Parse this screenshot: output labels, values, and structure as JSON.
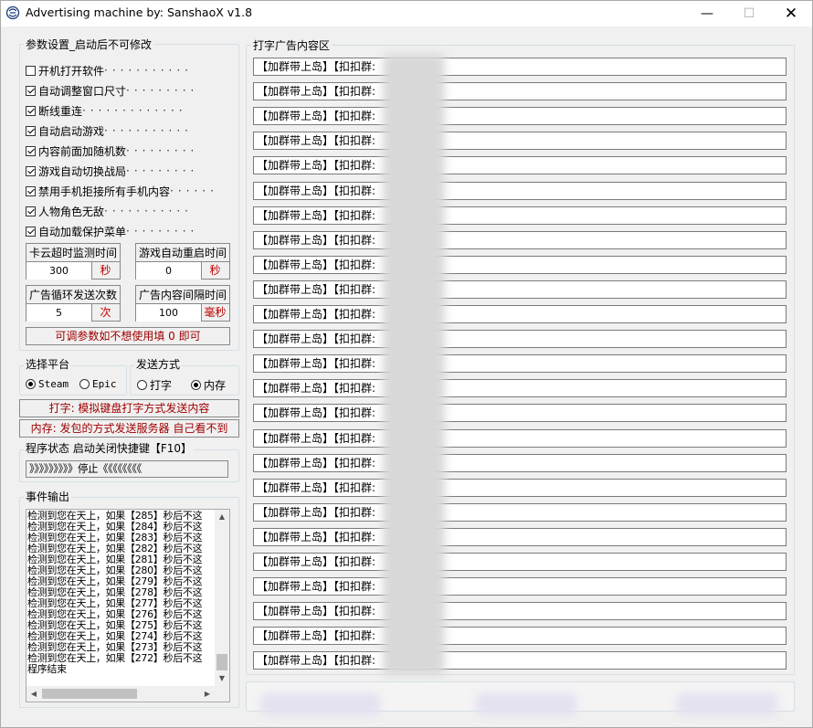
{
  "window": {
    "title": "Advertising machine by:  SanshaoX v1.8",
    "minimize": "—",
    "maximize": "☐",
    "close": "✕"
  },
  "params": {
    "group_label": "参数设置_启动后不可修改",
    "checkboxes": [
      {
        "label": "开机打开软件",
        "checked": false
      },
      {
        "label": "自动调整窗口尺寸",
        "checked": true
      },
      {
        "label": "断线重连",
        "checked": true
      },
      {
        "label": "自动启动游戏",
        "checked": true
      },
      {
        "label": "内容前面加随机数",
        "checked": true
      },
      {
        "label": "游戏自动切换战局",
        "checked": true
      },
      {
        "label": "禁用手机拒接所有手机内容",
        "checked": true
      },
      {
        "label": "人物角色无敌",
        "checked": true
      },
      {
        "label": "自动加载保护菜单",
        "checked": true
      }
    ],
    "fields": [
      {
        "label": "卡云超时监测时间",
        "value": "300",
        "unit": "秒"
      },
      {
        "label": "游戏自动重启时间",
        "value": "0",
        "unit": "秒"
      },
      {
        "label": "广告循环发送次数",
        "value": "5",
        "unit": "次"
      },
      {
        "label": "广告内容间隔时间",
        "value": "100",
        "unit": "毫秒"
      }
    ],
    "note": "可调参数如不想使用填 0 即可"
  },
  "platform": {
    "label": "选择平台",
    "options": [
      {
        "label": "Steam",
        "selected": true
      },
      {
        "label": "Epic",
        "selected": false
      }
    ]
  },
  "send_mode": {
    "label": "发送方式",
    "options": [
      {
        "label": "打字",
        "selected": false
      },
      {
        "label": "内存",
        "selected": true
      }
    ]
  },
  "hints": {
    "typing": "打字: 模拟键盘打字方式发送内容",
    "memory": "内存: 发包的方式发送服务器 自己看不到"
  },
  "status": {
    "label": "程序状态 启动关闭快捷键【F10】",
    "text": "》》》》》》》》》停止《《《《《《《《"
  },
  "events": {
    "label": "事件输出",
    "lines": [
      "检测到您在天上，如果【285】秒后不这",
      "检测到您在天上，如果【284】秒后不这",
      "检测到您在天上，如果【283】秒后不这",
      "检测到您在天上，如果【282】秒后不这",
      "检测到您在天上，如果【281】秒后不这",
      "检测到您在天上，如果【280】秒后不这",
      "检测到您在天上，如果【279】秒后不这",
      "检测到您在天上，如果【278】秒后不这",
      "检测到您在天上，如果【277】秒后不这",
      "检测到您在天上，如果【276】秒后不这",
      "检测到您在天上，如果【275】秒后不这",
      "检测到您在天上，如果【274】秒后不这",
      "检测到您在天上，如果【273】秒后不这",
      "检测到您在天上，如果【272】秒后不这",
      "程序结束"
    ],
    "scroll_up": "▲",
    "scroll_down": "▼",
    "scroll_left": "◀",
    "scroll_right": "▶"
  },
  "ads": {
    "label": "打字广告内容区",
    "items": [
      "【加群带上岛】【扣扣群:",
      "【加群带上岛】【扣扣群:",
      "【加群带上岛】【扣扣群:",
      "【加群带上岛】【扣扣群:",
      "【加群带上岛】【扣扣群:",
      "【加群带上岛】【扣扣群:",
      "【加群带上岛】【扣扣群:",
      "【加群带上岛】【扣扣群:",
      "【加群带上岛】【扣扣群:",
      "【加群带上岛】【扣扣群:",
      "【加群带上岛】【扣扣群:",
      "【加群带上岛】【扣扣群:",
      "【加群带上岛】【扣扣群:",
      "【加群带上岛】【扣扣群:",
      "【加群带上岛】【扣扣群:",
      "【加群带上岛】【扣扣群:",
      "【加群带上岛】【扣扣群:",
      "【加群带上岛】【扣扣群:",
      "【加群带上岛】【扣扣群:",
      "【加群带上岛】【扣扣群:",
      "【加群带上岛】【扣扣群:",
      "【加群带上岛】【扣扣群:",
      "【加群带上岛】【扣扣群:",
      "【加群带上岛】【扣扣群:",
      "【加群带上岛】【扣扣群:"
    ]
  }
}
